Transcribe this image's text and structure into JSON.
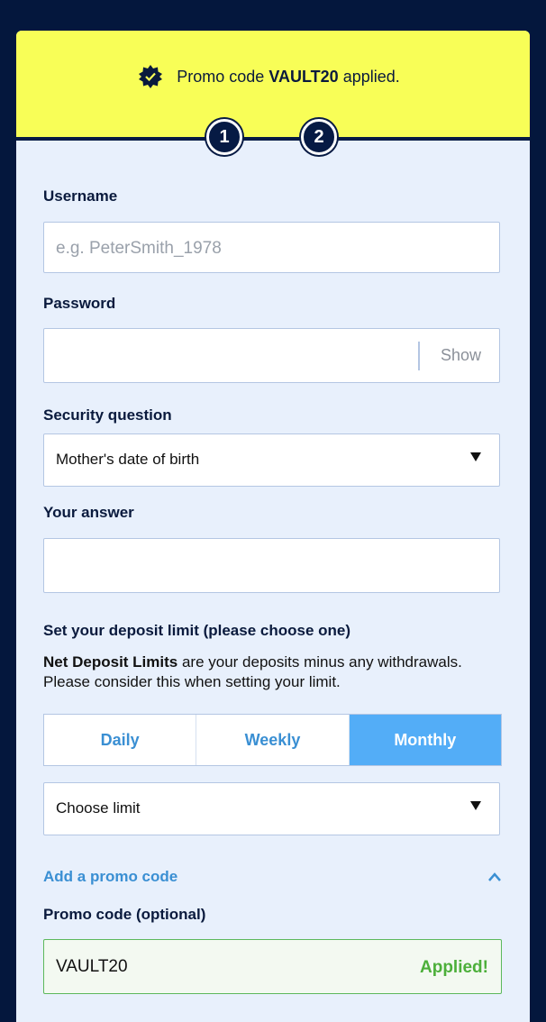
{
  "banner": {
    "prefix": "Promo code",
    "code": "VAULT20",
    "suffix": "applied.",
    "icon": "verified-badge-icon"
  },
  "steps": [
    "1",
    "2"
  ],
  "username": {
    "label": "Username",
    "placeholder": "e.g. PeterSmith_1978",
    "value": ""
  },
  "password": {
    "label": "Password",
    "value": "",
    "show_label": "Show"
  },
  "security": {
    "label": "Security question",
    "selected": "Mother's date of birth"
  },
  "answer": {
    "label": "Your answer",
    "value": ""
  },
  "deposit": {
    "heading": "Set your deposit limit (please choose one)",
    "desc_bold": "Net Deposit Limits",
    "desc_rest": " are your deposits minus any withdrawals. Please consider this when setting your limit.",
    "tabs": [
      "Daily",
      "Weekly",
      "Monthly"
    ],
    "active_tab": "Monthly",
    "limit_selected": "Choose limit"
  },
  "promo": {
    "toggle_label": "Add a promo code",
    "label": "Promo code (optional)",
    "value": "VAULT20",
    "status": "Applied!"
  },
  "colors": {
    "background": "#04173d",
    "banner": "#f8fe57",
    "card": "#e8f0fc",
    "accent": "#53adf7",
    "success": "#4caf3a"
  }
}
